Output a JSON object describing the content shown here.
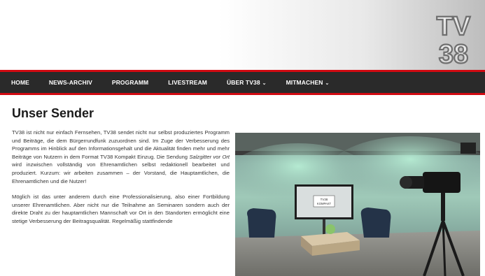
{
  "logo": {
    "text_top": "TV",
    "text_bottom": "38"
  },
  "nav": {
    "items": [
      {
        "label": "HOME",
        "dropdown": false
      },
      {
        "label": "NEWS-ARCHIV",
        "dropdown": false
      },
      {
        "label": "PROGRAMM",
        "dropdown": false
      },
      {
        "label": "LIVESTREAM",
        "dropdown": false
      },
      {
        "label": "ÜBER TV38",
        "dropdown": true
      },
      {
        "label": "MITMACHEN",
        "dropdown": true
      }
    ]
  },
  "page": {
    "title": "Unser Sender",
    "p1_a": "TV38 ist nicht nur einfach Fernsehen, TV38 sendet nicht nur selbst produziertes Programm und Beiträge, die dem Bürgerrundfunk zuzuordnen sind. Im Zuge der Verbesserung des Programms im Hinblick auf den Informationsgehalt und die Aktualität finden mehr und mehr Beiträge von Nutzern in dem Format TV38 Kompakt Einzug. Die Sendung ",
    "p1_em": "Salzgitter vor Ort",
    "p1_b": " wird inzwischen vollständig von Ehrenamtlichen selbst redaktionell bearbeitet und produziert. Kurzum: wir arbeiten zusammen – der Vorstand, die Hauptamtlichen, die Ehrenamtlichen und die Nutzer!",
    "p2": "Möglich ist das unter anderem durch eine Professionalisierung, also einer Fortbildung unserer Ehrenamtlichen. Aber nicht nur die Teilnahme an Seminaren sondern auch der direkte Draht zu der hauptamtlichen Mannschaft vor Ort in den Standorten ermöglicht eine stetige Verbesserung der Beitragsqualität. Regelmäßig stattfindende"
  },
  "studio_image": {
    "screen_line1": "TV38",
    "screen_line2": "KOMPAKT"
  },
  "colors": {
    "nav_bg": "#2a2a2a",
    "accent_red": "#d10a12",
    "studio_glow": "#9fd9c0"
  }
}
